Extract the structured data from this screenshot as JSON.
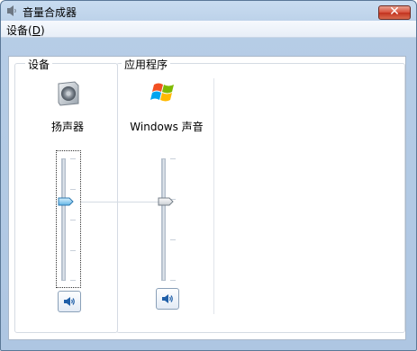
{
  "window": {
    "title": "音量合成器",
    "close_label": "✕"
  },
  "menu": {
    "device_label": "设备(",
    "device_accel": "D",
    "device_close": ")"
  },
  "devices": {
    "group_label": "设备",
    "speaker_label": "扬声器",
    "volume_percent": 65
  },
  "applications": {
    "group_label": "应用程序",
    "windows_sounds_label": "Windows 声音",
    "volume_percent": 65
  },
  "icons": {
    "title": "speaker-icon",
    "device": "speaker-device-icon",
    "app": "windows-logo-icon",
    "mute": "speaker-mute-icon"
  },
  "colors": {
    "accent": "#4f9fd6",
    "close": "#c8412d"
  }
}
